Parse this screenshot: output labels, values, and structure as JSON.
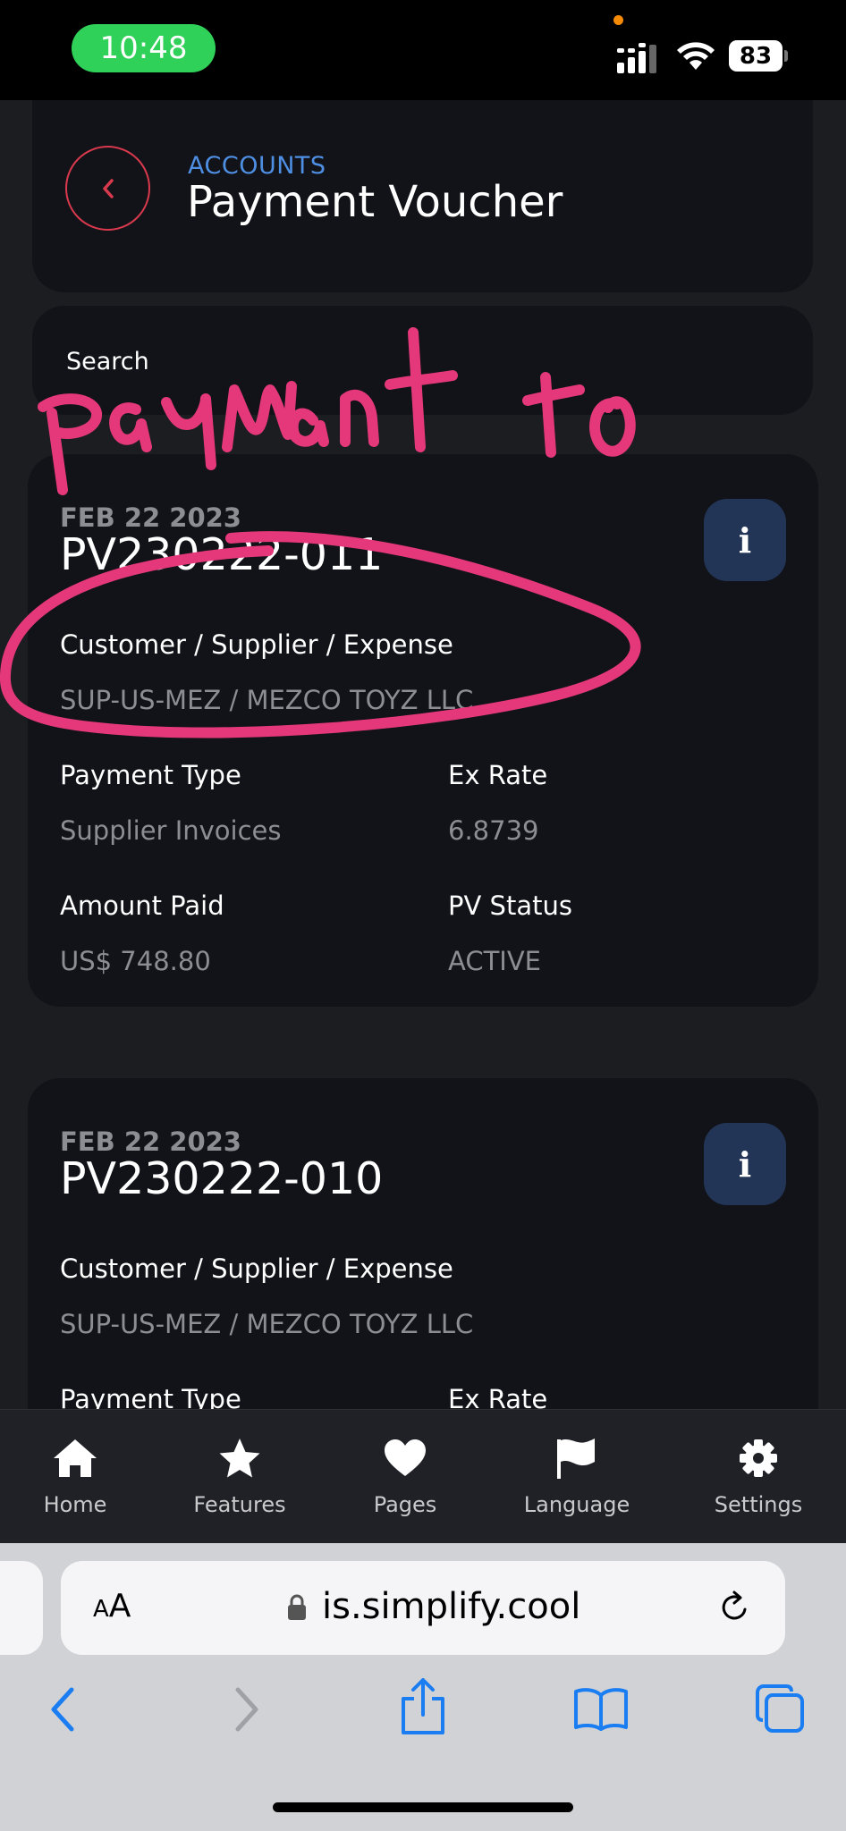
{
  "status_bar": {
    "time": "10:48",
    "battery": "83"
  },
  "header": {
    "eyebrow": "ACCOUNTS",
    "title": "Payment Voucher"
  },
  "search": {
    "placeholder": "Search"
  },
  "vouchers": [
    {
      "date": "FEB 22 2023",
      "number": "PV230222-011",
      "party_label": "Customer / Supplier / Expense",
      "party_value": "SUP-US-MEZ / MEZCO TOYZ LLC",
      "payment_type_label": "Payment Type",
      "payment_type_value": "Supplier Invoices",
      "ex_rate_label": "Ex Rate",
      "ex_rate_value": "6.8739",
      "amount_label": "Amount Paid",
      "amount_value": "US$ 748.80",
      "status_label": "PV Status",
      "status_value": "ACTIVE"
    },
    {
      "date": "FEB 22 2023",
      "number": "PV230222-010",
      "party_label": "Customer / Supplier / Expense",
      "party_value": "SUP-US-MEZ / MEZCO TOYZ LLC",
      "payment_type_label": "Payment Type",
      "ex_rate_label": "Ex Rate"
    }
  ],
  "info_button_glyph": "i",
  "nav": [
    {
      "label": "Home",
      "icon": "home-icon"
    },
    {
      "label": "Features",
      "icon": "star-icon"
    },
    {
      "label": "Pages",
      "icon": "heart-icon"
    },
    {
      "label": "Language",
      "icon": "flag-icon"
    },
    {
      "label": "Settings",
      "icon": "gear-icon"
    }
  ],
  "browser": {
    "text_size_small": "A",
    "text_size_large": "A",
    "url": "is.simplify.cool"
  },
  "colors": {
    "accent_red": "#d8394d",
    "accent_blue": "#4e8fe3",
    "card_bg": "#121318",
    "page_bg": "#1c1d21",
    "info_button_bg": "#223556",
    "annotation_pink": "#e5387a",
    "safari_blue": "#1a7df2"
  }
}
